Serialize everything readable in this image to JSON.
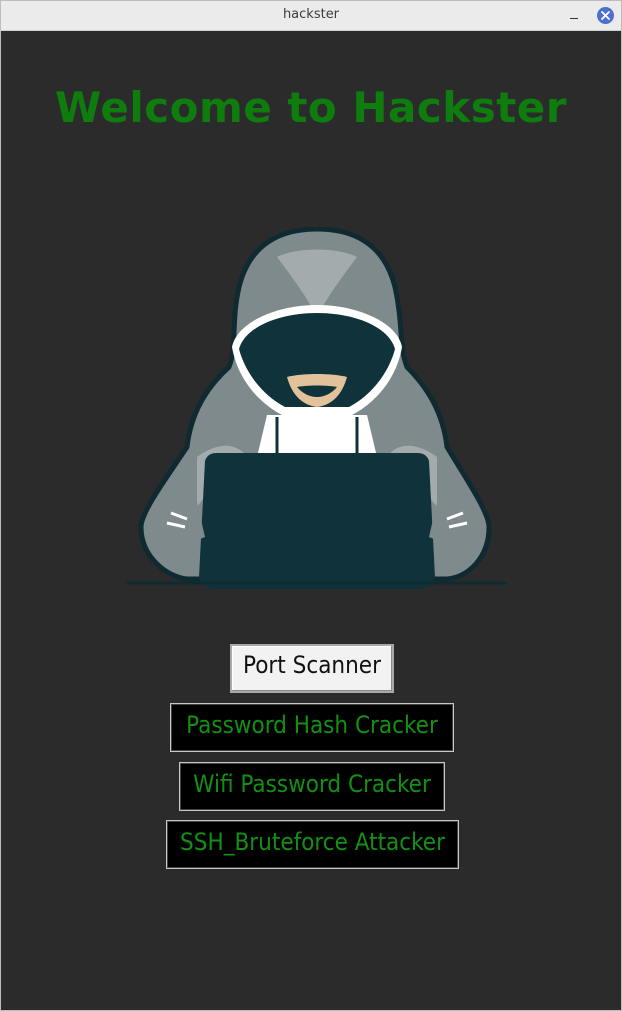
{
  "window": {
    "title": "hackster"
  },
  "main": {
    "heading": "Welcome to Hackster",
    "image_icon": "hooded-hacker-with-laptop"
  },
  "buttons": [
    {
      "label": "Port Scanner",
      "style": "light"
    },
    {
      "label": "Password Hash Cracker",
      "style": "dark"
    },
    {
      "label": "Wifi Password Cracker",
      "style": "dark"
    },
    {
      "label": "SSH_Bruteforce Attacker",
      "style": "dark"
    }
  ],
  "colors": {
    "background": "#2b2b2b",
    "heading_green": "#0e7d0e",
    "button_text_green": "#139013",
    "titlebar": "#ebebeb",
    "close_button": "#4c6fd0"
  }
}
